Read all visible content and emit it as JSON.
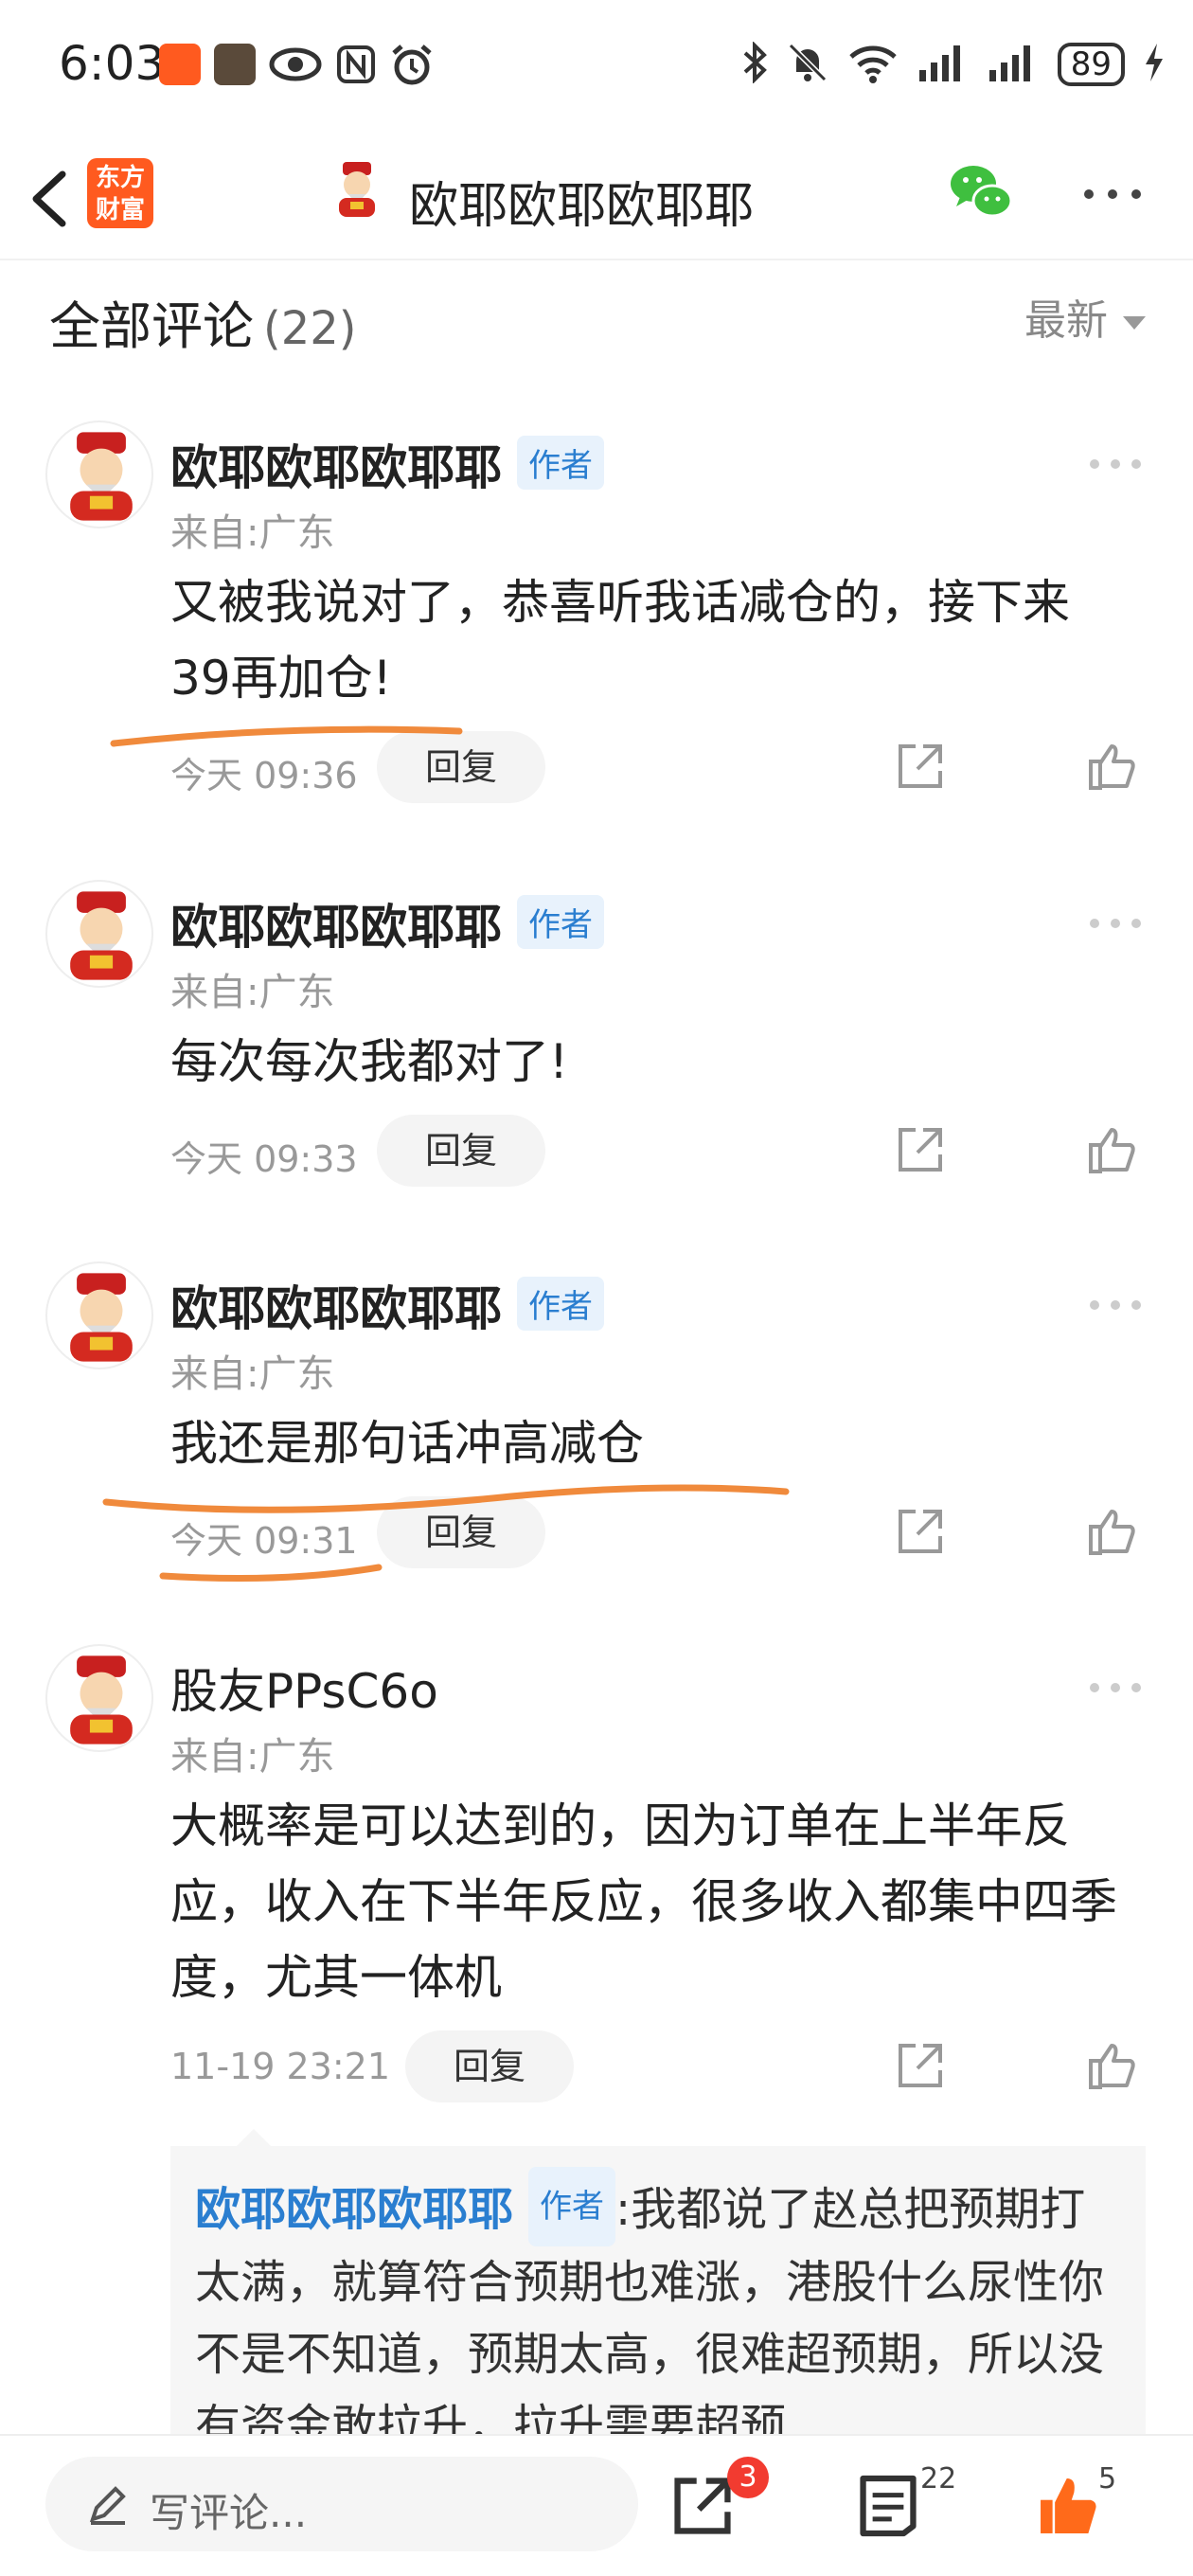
{
  "status": {
    "time": "6:03",
    "battery": "89"
  },
  "header": {
    "logo_line1": "东方",
    "logo_line2": "财富",
    "title": "欧耶欧耶欧耶耶"
  },
  "comments_header": {
    "label": "全部评论",
    "count": "(22)",
    "sort": "最新"
  },
  "comments": [
    {
      "name": "欧耶欧耶欧耶耶",
      "tag": "作者",
      "from": "来自:广东",
      "text": "又被我说对了，恭喜听我话减仓的，接下来39再加仓!",
      "time": "今天 09:36",
      "reply": "回复"
    },
    {
      "name": "欧耶欧耶欧耶耶",
      "tag": "作者",
      "from": "来自:广东",
      "text": "每次每次我都对了!",
      "time": "今天 09:33",
      "reply": "回复"
    },
    {
      "name": "欧耶欧耶欧耶耶",
      "tag": "作者",
      "from": "来自:广东",
      "text": "我还是那句话冲高减仓",
      "time": "今天 09:31",
      "reply": "回复"
    },
    {
      "name": "股友PPsC6o",
      "tag": "",
      "from": "来自:广东",
      "text": "大概率是可以达到的，因为订单在上半年反应，收入在下半年反应，很多收入都集中四季度，尤其一体机",
      "time": "11-19 23:21",
      "reply": "回复"
    }
  ],
  "nested_reply": {
    "name": "欧耶欧耶欧耶耶",
    "tag": "作者",
    "text": ":我都说了赵总把预期打太满，就算符合预期也难涨，港股什么尿性你不是不知道，预期太高，很难超预期，所以没有资金敢拉升，拉升需要超预"
  },
  "bottom": {
    "compose_placeholder": "写评论...",
    "share_badge": "3",
    "comment_count": "22",
    "like_count": "5"
  },
  "colors": {
    "accent": "#ff5a1f",
    "link_blue": "#2a7ed0",
    "annotation_orange": "#f08a3c"
  }
}
